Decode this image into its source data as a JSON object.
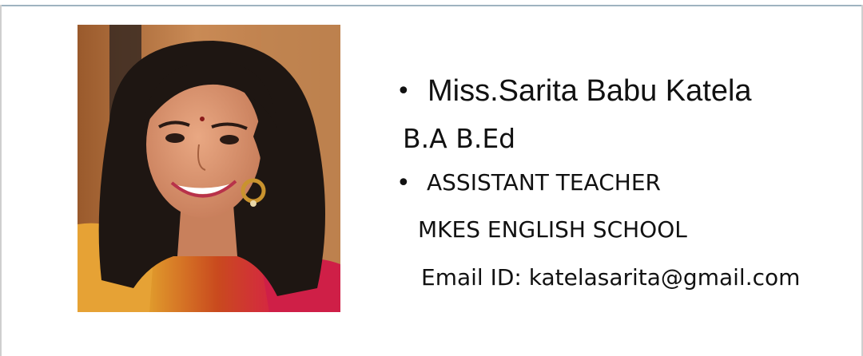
{
  "profile": {
    "name": "Miss.Sarita Babu Katela",
    "degree": "B.A B.Ed",
    "role": "ASSISTANT TEACHER",
    "school": "MKES ENGLISH SCHOOL",
    "email": "Email ID: katelasarita@gmail.com",
    "bullet": "•"
  },
  "colors": {
    "background": "#ffffff",
    "text": "#111111",
    "top_rule": "#9fb3c0"
  }
}
